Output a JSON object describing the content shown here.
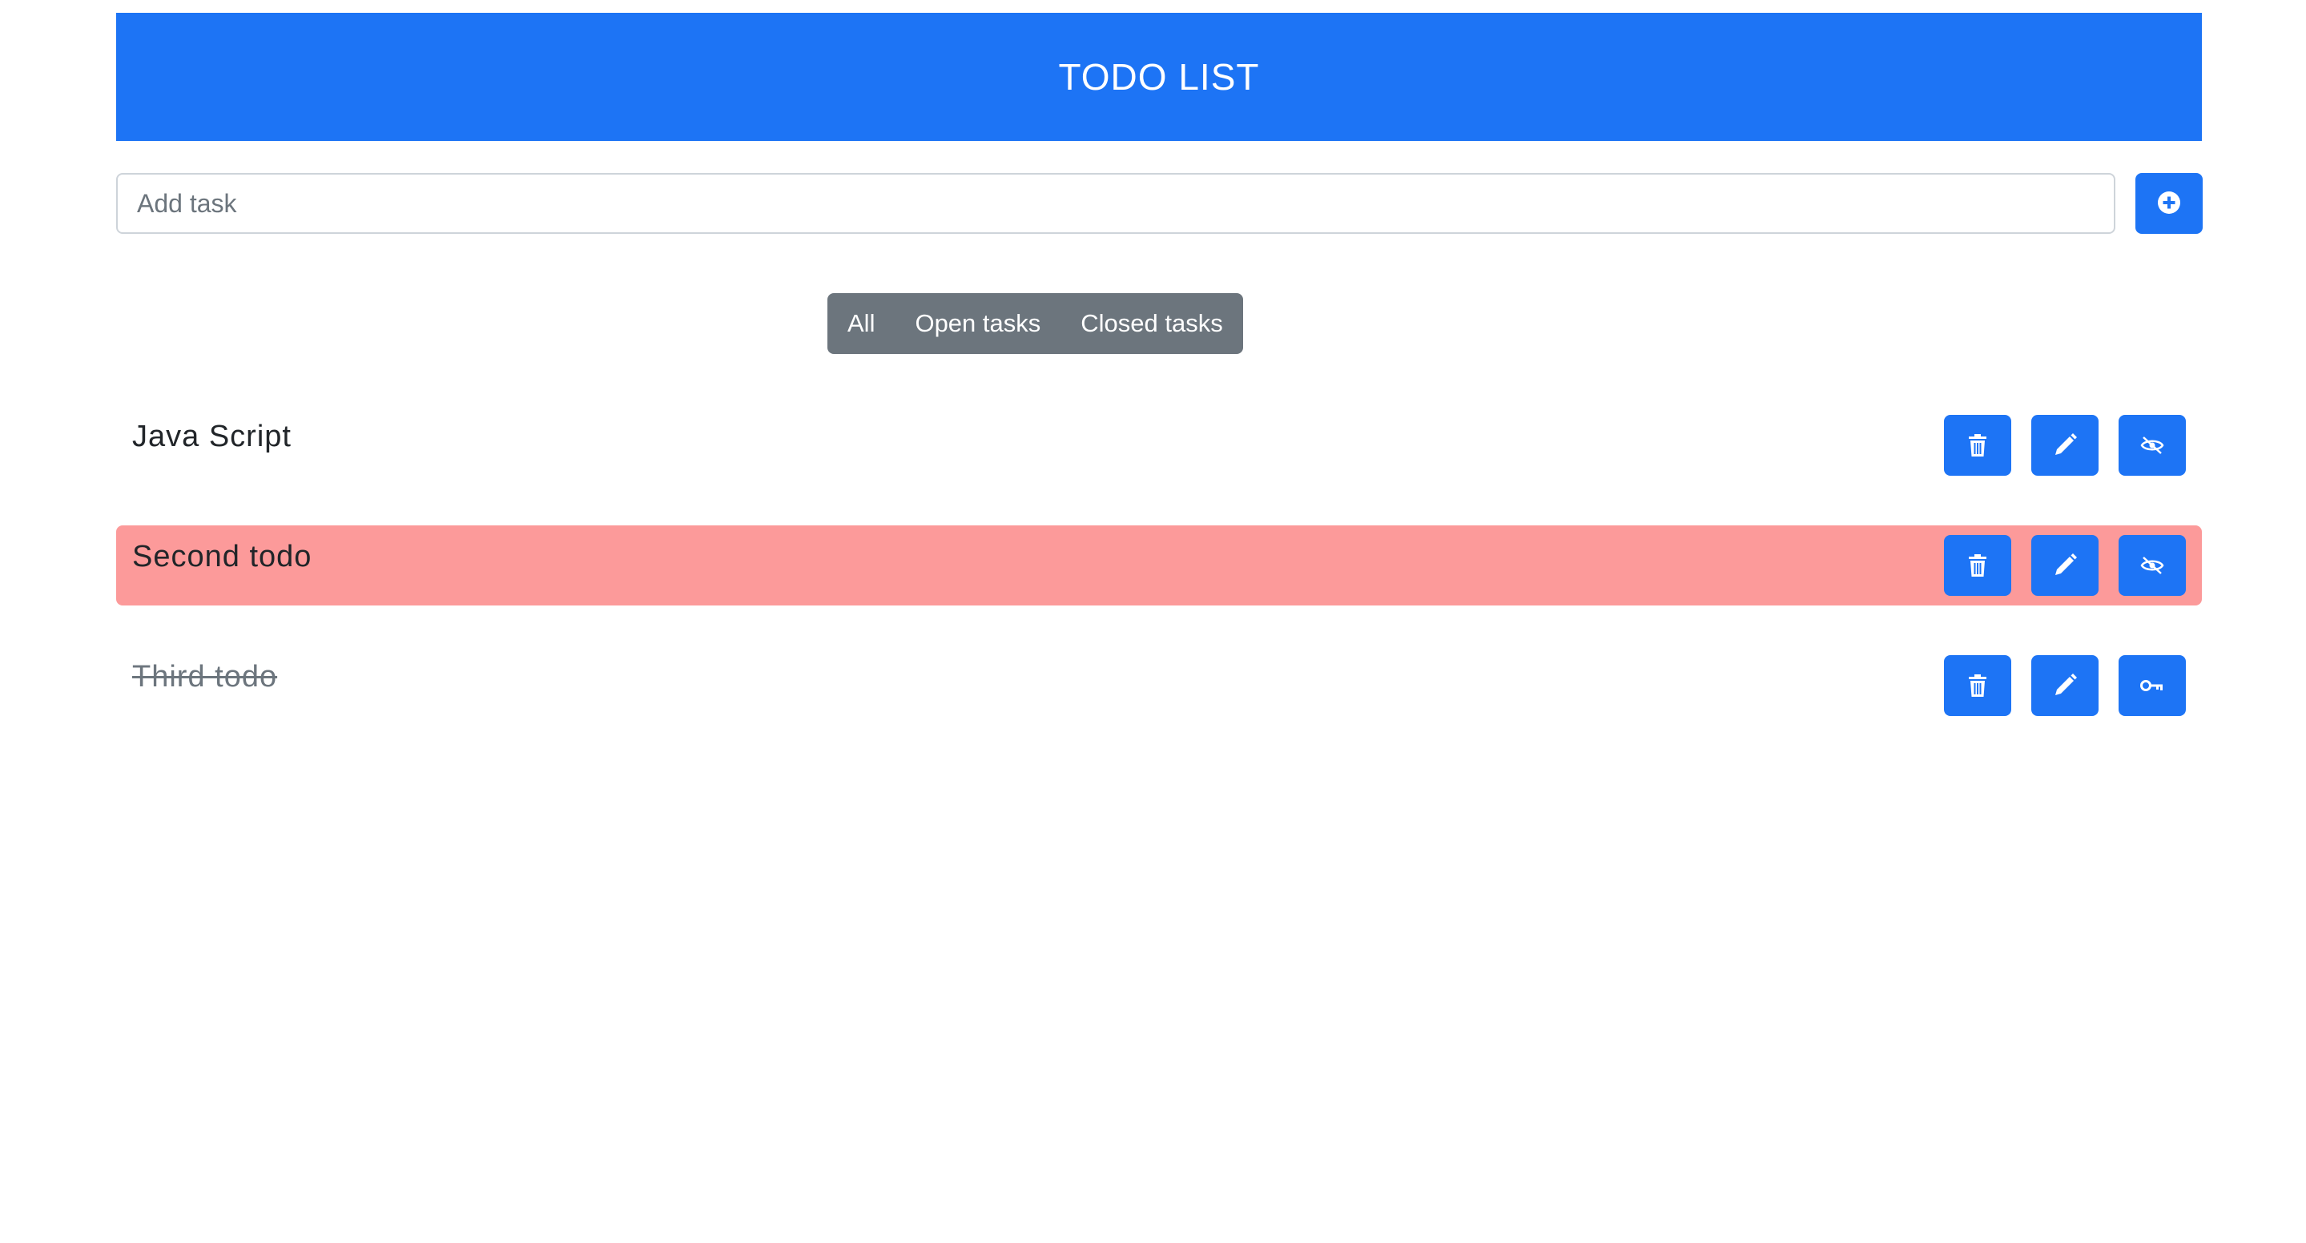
{
  "header": {
    "title": "TODO LIST"
  },
  "add_task": {
    "placeholder": "Add task",
    "value": "",
    "button_icon": "plus-circle-icon"
  },
  "filters": {
    "all": "All",
    "open": "Open tasks",
    "closed": "Closed tasks"
  },
  "todos": [
    {
      "text": "Java Script",
      "highlighted": false,
      "completed": false,
      "toggle_icon": "eye-slash-icon"
    },
    {
      "text": "Second todo",
      "highlighted": true,
      "completed": false,
      "toggle_icon": "eye-slash-icon"
    },
    {
      "text": "Third todo",
      "highlighted": false,
      "completed": true,
      "toggle_icon": "key-icon"
    }
  ],
  "colors": {
    "primary": "#1d74f5",
    "highlight_row": "#fc9a9a",
    "filter_group": "#6c757d"
  }
}
